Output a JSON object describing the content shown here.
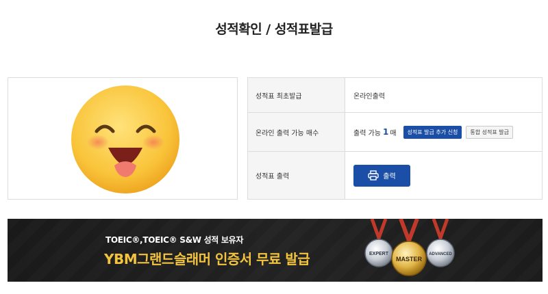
{
  "page": {
    "title": "성적확인 / 성적표발급"
  },
  "rows": [
    {
      "label": "성적표 최초발급",
      "value": "온라인출력"
    },
    {
      "label": "온라인 출력 가능 매수",
      "value_prefix": "출력 가능",
      "count": "1",
      "value_suffix": "매",
      "add_button": "성적표 발급 추가 신청",
      "merge_button": "통합 성적표 발급"
    },
    {
      "label": "성적표 출력",
      "print_button": "출력"
    }
  ],
  "banner": {
    "sub_text": "TOEIC®,TOEIC® S&W 성적 보유자",
    "main_text": "YBM그랜드슬래머 인증서 무료 발급",
    "medals": [
      "EXPERT",
      "MASTER",
      "ADVANCED"
    ]
  },
  "colors": {
    "primary": "#1b4ea6",
    "banner_gold": "#f3c33e",
    "banner_bg": "#1e1e1e"
  },
  "icons": {
    "printer": "printer-icon",
    "emoji": "smiling-face-emoji"
  }
}
